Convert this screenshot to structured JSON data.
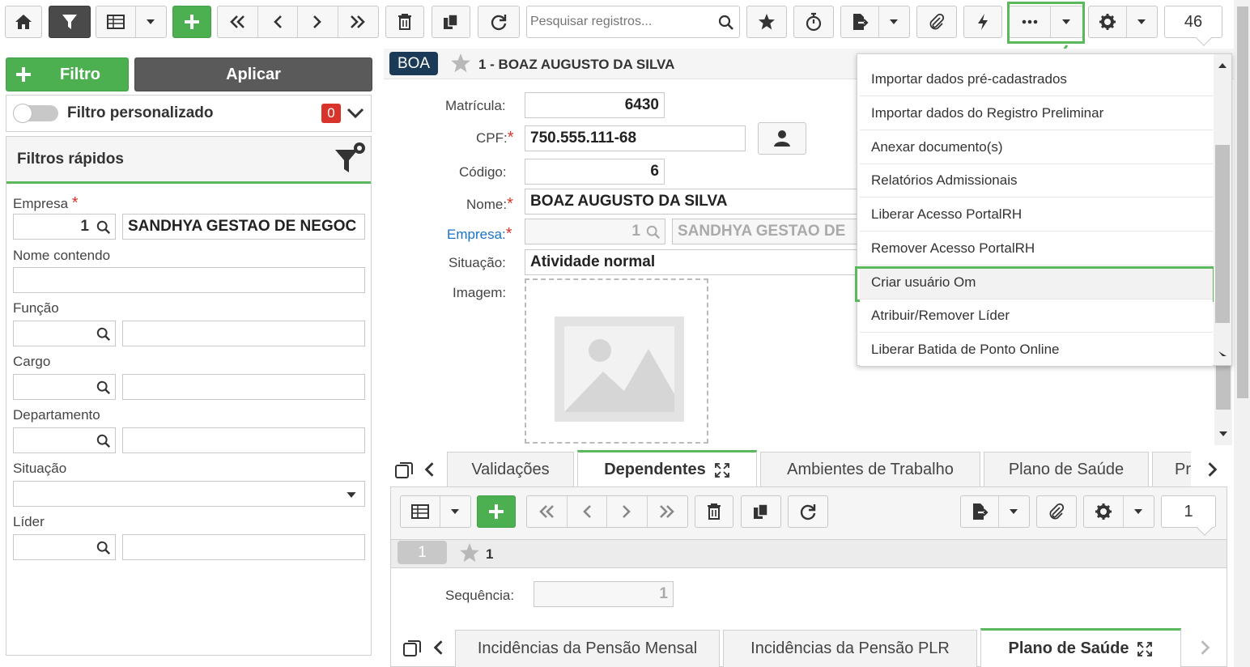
{
  "toolbar": {
    "search_placeholder": "Pesquisar registros...",
    "record_count": "46"
  },
  "sidebar": {
    "filter_button": "Filtro",
    "apply_button": "Aplicar",
    "custom_filter_label": "Filtro personalizado",
    "custom_filter_count": "0",
    "quick_filters_title": "Filtros rápidos",
    "empresa_label": "Empresa",
    "empresa_code": "1",
    "empresa_name": "SANDHYA GESTAO DE NEGOC",
    "nome_label": "Nome contendo",
    "funcao_label": "Função",
    "cargo_label": "Cargo",
    "departamento_label": "Departamento",
    "situacao_label": "Situação",
    "lider_label": "Líder"
  },
  "record": {
    "badge": "BOA",
    "title": "1 - BOAZ AUGUSTO DA SILVA",
    "matricula_label": "Matrícula:",
    "matricula_value": "6430",
    "cpf_label": "CPF:",
    "cpf_value": "750.555.111-68",
    "codigo_label": "Código:",
    "codigo_value": "6",
    "nome_label": "Nome:",
    "nome_value": "BOAZ AUGUSTO DA SILVA",
    "empresa_label": "Empresa:",
    "empresa_code": "1",
    "empresa_name": "SANDHYA GESTAO DE",
    "situacao_label": "Situação:",
    "situacao_value": "Atividade normal",
    "imagem_label": "Imagem:"
  },
  "dropdown_menu": {
    "items": [
      "Importar dados pré-cadastrados",
      "Importar dados do Registro Preliminar",
      "Anexar documento(s)",
      "Relatórios Admissionais",
      "Liberar Acesso PortalRH",
      "Remover Acesso PortalRH",
      "Criar usuário Om",
      "Atribuir/Remover Líder",
      "Liberar Batida de Ponto Online"
    ],
    "highlighted_index": 6
  },
  "tabs": {
    "items": [
      "Validações",
      "Dependentes",
      "Ambientes de Trabalho",
      "Plano de Saúde",
      "Pr"
    ],
    "active": "Dependentes"
  },
  "sub": {
    "record_count": "1",
    "row_badge": "1",
    "row_title": "1",
    "sequencia_label": "Sequência:",
    "sequencia_value": "1",
    "tabs": [
      "Incidências da Pensão Mensal",
      "Incidências da Pensão PLR",
      "Plano de Saúde"
    ],
    "active_tab": "Plano de Saúde"
  },
  "colors": {
    "accent_green": "#5cb85c",
    "link_blue": "#1a73c8",
    "badge_navy": "#1b3a57",
    "required_red": "#d9342b"
  }
}
